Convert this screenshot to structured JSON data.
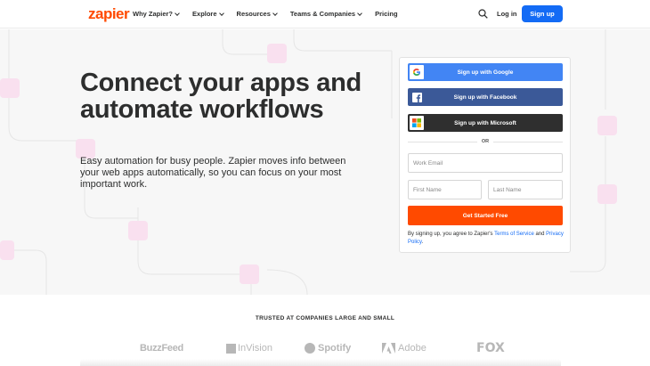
{
  "nav": {
    "logo": "zapier",
    "menu": [
      {
        "label": "Why Zapier?",
        "dropdown": true
      },
      {
        "label": "Explore",
        "dropdown": true
      },
      {
        "label": "Resources",
        "dropdown": true
      },
      {
        "label": "Teams & Companies",
        "dropdown": true
      },
      {
        "label": "Pricing",
        "dropdown": false
      }
    ],
    "login": "Log in",
    "signup": "Sign up"
  },
  "hero": {
    "title": "Connect your apps and automate workflows",
    "subtitle": "Easy automation for busy people. Zapier moves info between your web apps automatically, so you can focus on your most important work."
  },
  "form": {
    "google": "Sign up with Google",
    "facebook": "Sign up with Facebook",
    "microsoft": "Sign up with Microsoft",
    "or": "OR",
    "email_placeholder": "Work Email",
    "first_placeholder": "First Name",
    "last_placeholder": "Last Name",
    "cta": "Get Started Free",
    "terms_prefix": "By signing up, you agree to Zapier's",
    "terms_link": "Terms of Service",
    "terms_and": "and",
    "privacy_link": "Privacy Policy",
    "terms_suffix": "."
  },
  "trusted": {
    "title": "TRUSTED AT COMPANIES LARGE AND SMALL",
    "brands": [
      "BuzzFeed",
      "InVision",
      "Spotify",
      "Adobe",
      "FOX"
    ]
  },
  "colors": {
    "accent": "#ff4a00",
    "primary": "#136bf5",
    "google": "#4285f4",
    "facebook": "#3b5998",
    "microsoft": "#2f2f2f"
  }
}
